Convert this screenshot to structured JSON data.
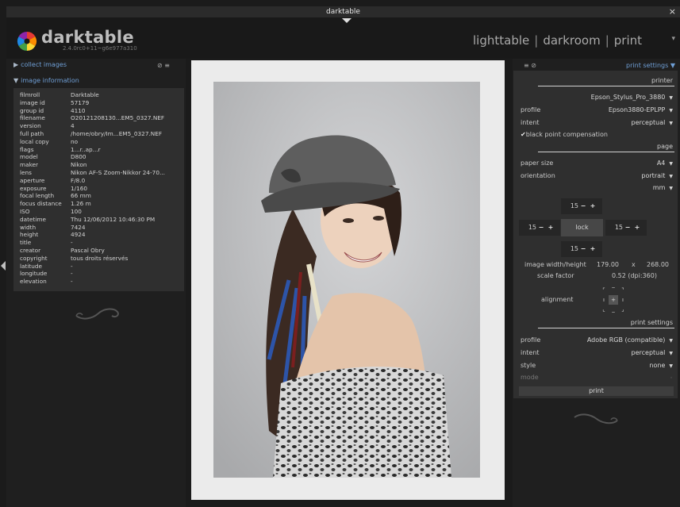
{
  "window": {
    "title": "darktable",
    "close_glyph": "×"
  },
  "header": {
    "app_name": "darktable",
    "version": "2.4.0rc0+11~g6e977a310",
    "views": [
      "lighttable",
      "darkroom",
      "print"
    ],
    "view_separator": "|",
    "arrow_glyph": "▾"
  },
  "left": {
    "collect_label": "collect images",
    "collect_icons": "⊘ ≡",
    "info_label": "image information",
    "expand_glyph": "▶",
    "collapse_glyph": "▼",
    "info": [
      {
        "k": "filmroll",
        "v": "Darktable"
      },
      {
        "k": "image id",
        "v": "57179"
      },
      {
        "k": "group id",
        "v": "4110"
      },
      {
        "k": "filename",
        "v": "O20121208130...EM5_0327.NEF"
      },
      {
        "k": "version",
        "v": "4"
      },
      {
        "k": "full path",
        "v": "/home/obry/Im...EM5_0327.NEF"
      },
      {
        "k": "local copy",
        "v": "no"
      },
      {
        "k": "flags",
        "v": "1...r..ap...r"
      },
      {
        "k": "model",
        "v": "D800"
      },
      {
        "k": "maker",
        "v": "Nikon"
      },
      {
        "k": "lens",
        "v": "Nikon AF-S Zoom-Nikkor 24-70..."
      },
      {
        "k": "aperture",
        "v": "F/8.0"
      },
      {
        "k": "exposure",
        "v": "1/160"
      },
      {
        "k": "focal length",
        "v": "66 mm"
      },
      {
        "k": "focus distance",
        "v": "1.26 m"
      },
      {
        "k": "ISO",
        "v": "100"
      },
      {
        "k": "datetime",
        "v": "Thu 12/06/2012 10:46:30 PM"
      },
      {
        "k": "width",
        "v": "7424"
      },
      {
        "k": "height",
        "v": "4924"
      },
      {
        "k": "title",
        "v": "-"
      },
      {
        "k": "creator",
        "v": "Pascal Obry"
      },
      {
        "k": "copyright",
        "v": "tous droits réservés"
      },
      {
        "k": "latitude",
        "v": "-"
      },
      {
        "k": "longitude",
        "v": "-"
      },
      {
        "k": "elevation",
        "v": "-"
      }
    ]
  },
  "right": {
    "top_icons": "≡ ⊘",
    "top_title": "print settings",
    "top_arrow": "▼",
    "printer": {
      "section": "printer",
      "printer_name": "Epson_Stylus_Pro_3880",
      "profile_label": "profile",
      "profile_value": "Epson3880-EPLPP",
      "intent_label": "intent",
      "intent_value": "perceptual",
      "bpc_label": "black point compensation",
      "bpc_check": "✔"
    },
    "page": {
      "section": "page",
      "paper_size_label": "paper size",
      "paper_size_value": "A4",
      "orientation_label": "orientation",
      "orientation_value": "portrait",
      "unit_value": "mm",
      "margin_top": "15",
      "margin_left": "15",
      "margin_right": "15",
      "margin_bottom": "15",
      "minus": "−",
      "plus": "+",
      "lock_label": "lock",
      "dims_label": "image width/height",
      "width_value": "179.00",
      "x_label": "x",
      "height_value": "268.00",
      "scale_label": "scale factor",
      "scale_value": "0.52 (dpi:360)",
      "alignment_label": "alignment"
    },
    "settings": {
      "section": "print settings",
      "profile_label": "profile",
      "profile_value": "Adobe RGB (compatible)",
      "intent_label": "intent",
      "intent_value": "perceptual",
      "style_label": "style",
      "style_value": "none",
      "mode_label": "mode"
    },
    "print_button": "print",
    "dropdown_glyph": "▼"
  }
}
